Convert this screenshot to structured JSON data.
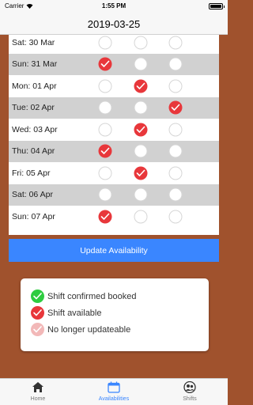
{
  "status_bar": {
    "carrier": "Carrier",
    "time": "1:55 PM"
  },
  "nav": {
    "title": "2019-03-25"
  },
  "schedule": {
    "rows": [
      {
        "label": "Sat: 30 Mar",
        "shaded": false,
        "slots": [
          "empty",
          "empty",
          "empty"
        ]
      },
      {
        "label": "Sun: 31 Mar",
        "shaded": true,
        "slots": [
          "checked",
          "empty",
          "empty"
        ]
      },
      {
        "label": "Mon: 01 Apr",
        "shaded": false,
        "slots": [
          "empty",
          "checked",
          "empty"
        ]
      },
      {
        "label": "Tue: 02 Apr",
        "shaded": true,
        "slots": [
          "empty",
          "empty",
          "checked"
        ]
      },
      {
        "label": "Wed: 03 Apr",
        "shaded": false,
        "slots": [
          "empty",
          "checked",
          "empty"
        ]
      },
      {
        "label": "Thu: 04 Apr",
        "shaded": true,
        "slots": [
          "checked",
          "empty",
          "empty"
        ]
      },
      {
        "label": "Fri: 05 Apr",
        "shaded": false,
        "slots": [
          "empty",
          "checked",
          "empty"
        ]
      },
      {
        "label": "Sat: 06 Apr",
        "shaded": true,
        "slots": [
          "empty",
          "empty",
          "empty"
        ]
      },
      {
        "label": "Sun: 07 Apr",
        "shaded": false,
        "slots": [
          "checked",
          "empty",
          "empty"
        ]
      }
    ]
  },
  "update_button": {
    "label": "Update Availability"
  },
  "legend": {
    "items": [
      {
        "label": "Shift confirmed booked",
        "color": "#2ecc40",
        "icon": "check-circle-icon"
      },
      {
        "label": "Shift available",
        "color": "#e8373b",
        "icon": "check-circle-icon"
      },
      {
        "label": "No longer updateable",
        "color": "#f2b8b8",
        "icon": "check-circle-icon"
      }
    ]
  },
  "colors": {
    "checked": "#e8373b",
    "shaded_row": "#d1d1d1",
    "accent": "#3a86ff",
    "background": "#a0522d"
  },
  "tabs": [
    {
      "label": "Home",
      "icon": "home-icon",
      "active": false
    },
    {
      "label": "Availabilities",
      "icon": "calendar-icon",
      "active": true
    },
    {
      "label": "Shifts",
      "icon": "people-icon",
      "active": false
    }
  ]
}
